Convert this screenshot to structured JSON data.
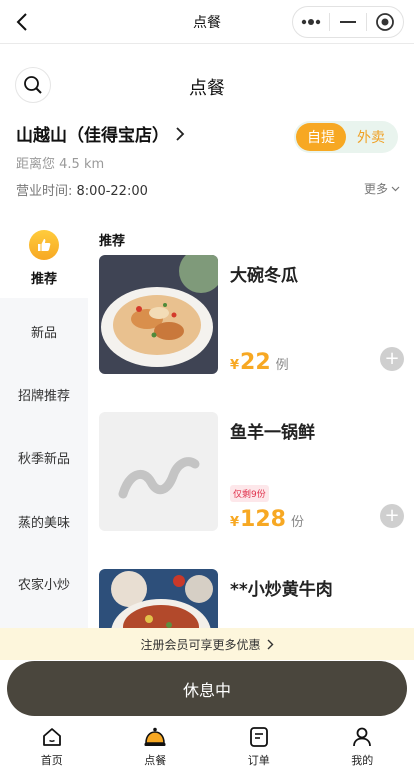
{
  "navbar": {
    "title": "点餐"
  },
  "page": {
    "title": "点餐"
  },
  "store": {
    "name": "山越山（佳得宝店）",
    "distance": "距离您 4.5 km",
    "hours_label": "营业时间:",
    "hours_value": "8:00-22:00",
    "more_label": "更多"
  },
  "delivery_toggle": {
    "pickup": "自提",
    "delivery": "外卖",
    "selected": "自提"
  },
  "sidebar": {
    "recommend_label": "推荐",
    "items": [
      "新品",
      "招牌推荐",
      "秋季新品",
      "蒸的美味",
      "农家小炒"
    ]
  },
  "menu": {
    "section_title": "推荐",
    "items": [
      {
        "name": "大碗冬瓜",
        "price_symbol": "¥",
        "price": "22",
        "unit": "例",
        "tag": ""
      },
      {
        "name": "鱼羊一锅鲜",
        "price_symbol": "¥",
        "price": "128",
        "unit": "份",
        "tag": "仅剩9份"
      },
      {
        "name": "**小炒黄牛肉",
        "price_symbol": "",
        "price": "",
        "unit": "",
        "tag": ""
      }
    ]
  },
  "promo": {
    "text": "注册会员可享更多优惠"
  },
  "action_button": {
    "label": "休息中"
  },
  "tabbar": {
    "items": [
      {
        "label": "首页",
        "icon": "home-icon"
      },
      {
        "label": "点餐",
        "icon": "bell-icon"
      },
      {
        "label": "订单",
        "icon": "order-icon"
      },
      {
        "label": "我的",
        "icon": "profile-icon"
      }
    ],
    "active": "点餐"
  },
  "colors": {
    "accent": "#f7a823",
    "dark_button": "#4a463d",
    "promo_bg": "#fdf6dc",
    "sidebar_bg": "#f6f7f9"
  }
}
